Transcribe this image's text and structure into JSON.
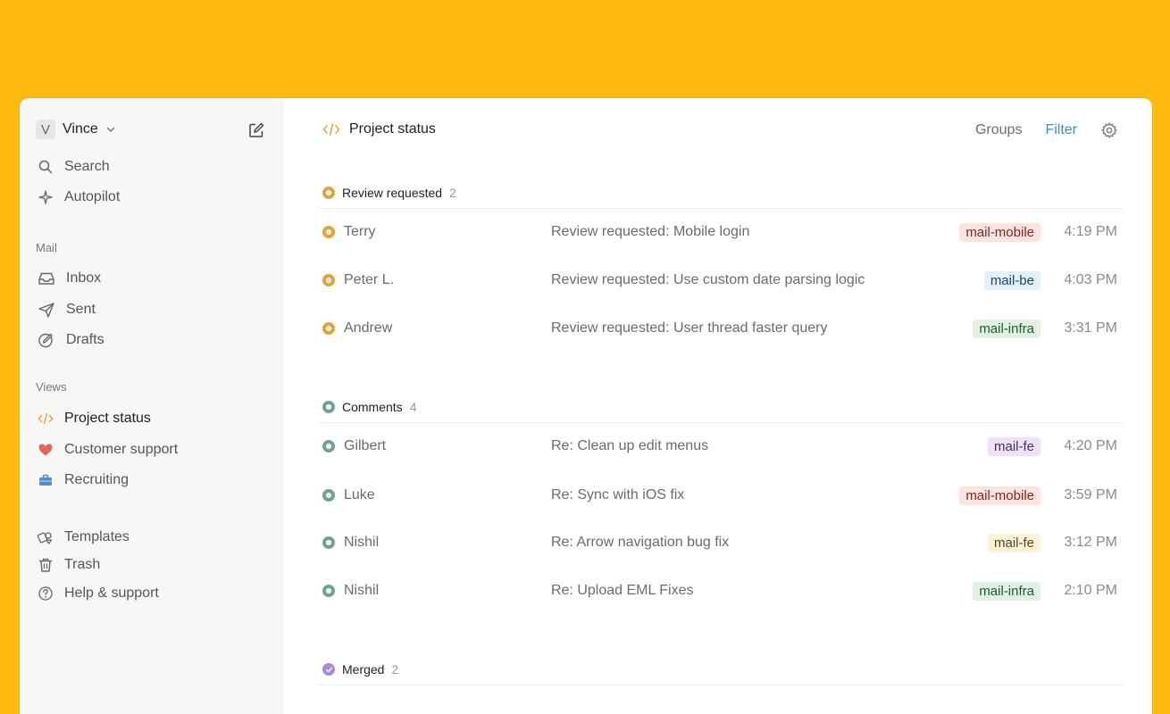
{
  "account": {
    "initial": "V",
    "name": "Vince"
  },
  "sidebar": {
    "top_items": [
      {
        "label": "Search",
        "icon": "search-icon"
      },
      {
        "label": "Autopilot",
        "icon": "sparkle-icon"
      }
    ],
    "mail_label": "Mail",
    "mail_items": [
      {
        "label": "Inbox",
        "icon": "inbox-icon"
      },
      {
        "label": "Sent",
        "icon": "send-icon"
      },
      {
        "label": "Drafts",
        "icon": "draft-icon"
      }
    ],
    "views_label": "Views",
    "view_items": [
      {
        "label": "Project status",
        "icon": "code-icon"
      },
      {
        "label": "Customer support",
        "icon": "heart-icon"
      },
      {
        "label": "Recruiting",
        "icon": "briefcase-icon"
      }
    ],
    "bottom_items": [
      {
        "label": "Templates",
        "icon": "templates-icon"
      },
      {
        "label": "Trash",
        "icon": "trash-icon"
      },
      {
        "label": "Help & support",
        "icon": "help-icon"
      }
    ]
  },
  "header": {
    "title": "Project status",
    "groups_label": "Groups",
    "filter_label": "Filter"
  },
  "colors": {
    "review": "#E3A33A",
    "comments": "#6FA58A",
    "merged": "#A98BD2",
    "accent_link": "#3a8fc9"
  },
  "groups": [
    {
      "title": "Review requested",
      "count": "2",
      "rows": [
        {
          "name": "Terry",
          "subject": "Review requested: Mobile login",
          "tag": "mail-mobile",
          "time": "4:19 PM"
        },
        {
          "name": "Peter L.",
          "subject": "Review requested: Use custom date parsing logic",
          "tag": "mail-be",
          "time": "4:03 PM"
        },
        {
          "name": "Andrew",
          "subject": "Review requested: User thread faster query",
          "tag": "mail-infra",
          "time": "3:31 PM"
        }
      ]
    },
    {
      "title": "Comments",
      "count": "4",
      "rows": [
        {
          "name": "Gilbert",
          "subject": "Re: Clean up edit menus",
          "tag": "mail-fe",
          "time": "4:20 PM"
        },
        {
          "name": "Luke",
          "subject": "Re: Sync with iOS fix",
          "tag": "mail-mobile",
          "time": "3:59 PM"
        },
        {
          "name": "Nishil",
          "subject": "Re: Arrow navigation bug fix",
          "tag": "mail-fe",
          "time": "3:12 PM"
        },
        {
          "name": "Nishil",
          "subject": "Re: Upload EML Fixes",
          "tag": "mail-infra",
          "time": "2:10 PM"
        }
      ]
    },
    {
      "title": "Merged",
      "count": "2",
      "rows": []
    }
  ]
}
